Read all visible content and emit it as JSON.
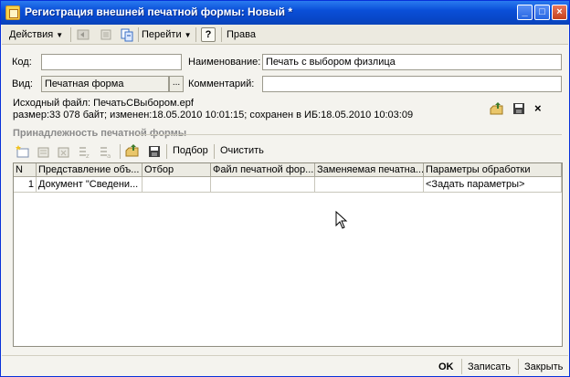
{
  "window": {
    "title": "Регистрация внешней печатной формы: Новый *",
    "minimize": "_",
    "maximize": "□",
    "close": "×"
  },
  "toolbar": {
    "actions_label": "Действия",
    "goto_label": "Перейти",
    "help_label": "?",
    "rights_label": "Права"
  },
  "form": {
    "code_label": "Код:",
    "code_value": "",
    "name_label": "Наименование:",
    "name_value": "Печать с выбором физлица",
    "kind_label": "Вид:",
    "kind_value": "Печатная форма",
    "kind_button": "...",
    "comment_label": "Комментарий:",
    "comment_value": "",
    "source_file": "Исходный файл: ПечатьСВыбором.epf",
    "file_info": "размер:33 078 байт; изменен:18.05.2010 10:01:15; сохранен в ИБ:18.05.2010 10:03:09"
  },
  "section": {
    "title": "Принадлежность печатной формы",
    "select_label": "Подбор",
    "clear_label": "Очистить"
  },
  "grid": {
    "columns": [
      "N",
      "Представление объ...",
      "Отбор",
      "Файл печатной фор...",
      "Заменяемая печатна...",
      "Параметры обработки"
    ],
    "rows": [
      [
        "1",
        "Документ \"Сведени...",
        "",
        "",
        "",
        "<Задать параметры>"
      ]
    ]
  },
  "footer": {
    "ok_label": "OK",
    "save_label": "Записать",
    "close_label": "Закрыть"
  }
}
